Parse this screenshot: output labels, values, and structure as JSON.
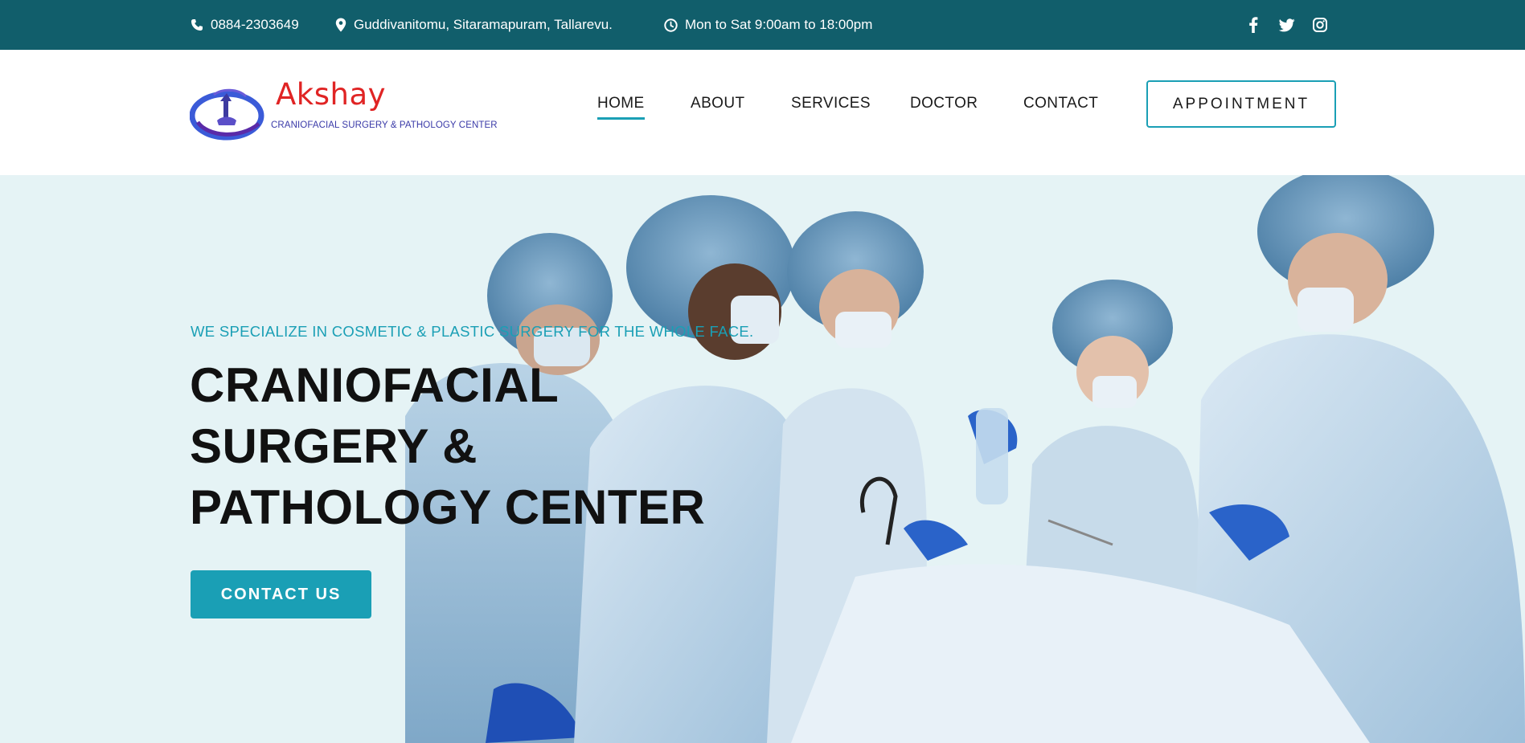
{
  "topbar": {
    "phone": "0884-2303649",
    "address": "Guddivanitomu, Sitaramapuram, Tallarevu.",
    "hours": "Mon to Sat 9:00am to 18:00pm",
    "phone_icon": "phone-icon",
    "address_icon": "map-pin-icon",
    "hours_icon": "clock-icon",
    "social": [
      "facebook-icon",
      "twitter-icon",
      "instagram-icon"
    ]
  },
  "brand": {
    "name": "Akshay",
    "tagline": "CRANIOFACIAL SURGERY & PATHOLOGY CENTER",
    "logo_icon": "clinic-logo-icon"
  },
  "nav": {
    "items": [
      {
        "label": "HOME",
        "active": true
      },
      {
        "label": "ABOUT",
        "active": false
      },
      {
        "label": "SERVICES",
        "active": false
      },
      {
        "label": "DOCTOR",
        "active": false
      },
      {
        "label": "CONTACT",
        "active": false
      }
    ],
    "appointment_label": "APPOINTMENT"
  },
  "hero": {
    "tagline": "WE SPECIALIZE IN COSMETIC & PLASTIC SURGERY FOR THE WHOLE FACE.",
    "headline": [
      "CRANIOFACIAL",
      "SURGERY &",
      "PATHOLOGY CENTER"
    ],
    "cta_label": "CONTACT US",
    "image_subject": "surgical-team-photo"
  },
  "colors": {
    "topbar": "#115e6b",
    "accent": "#1a9fb5",
    "brand_red": "#e02424",
    "hero_bg": "#e5f3f5"
  }
}
